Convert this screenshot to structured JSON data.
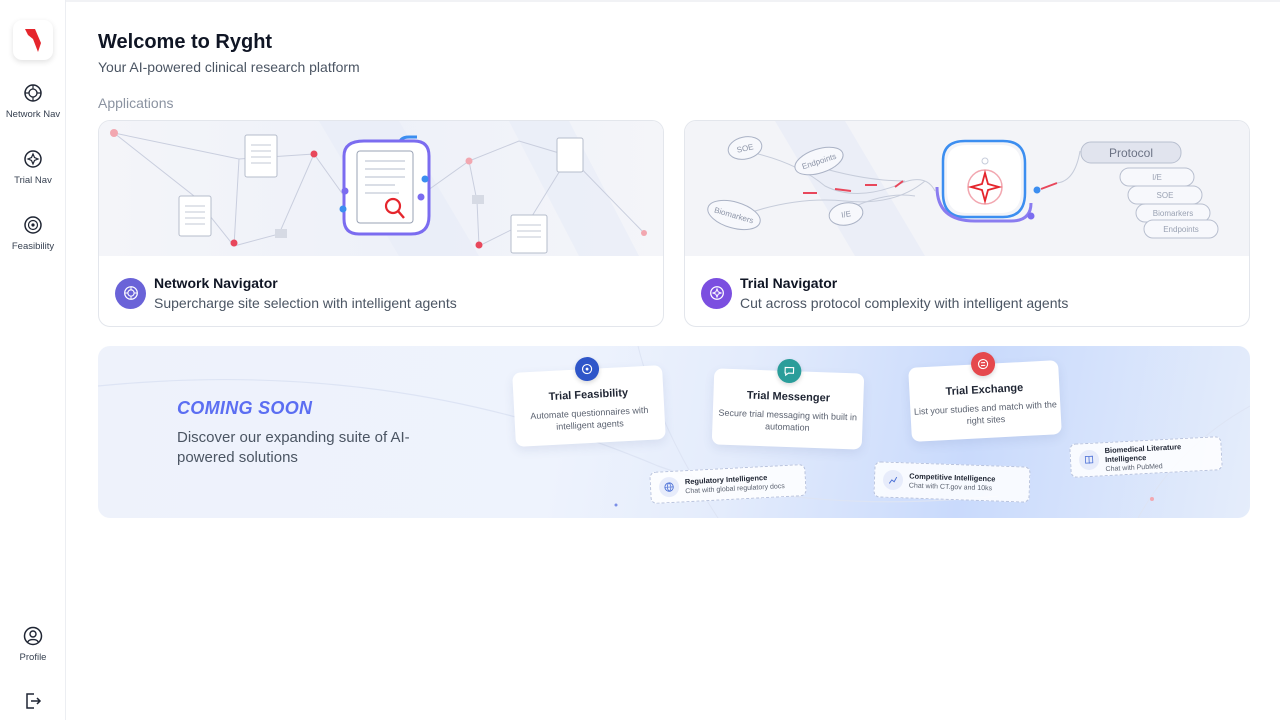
{
  "sidebar": {
    "items": [
      {
        "label": "Network Nav"
      },
      {
        "label": "Trial Nav"
      },
      {
        "label": "Feasibility"
      }
    ],
    "profile_label": "Profile"
  },
  "header": {
    "title": "Welcome to Ryght",
    "subtitle": "Your AI-powered clinical research platform"
  },
  "applications": {
    "section_label": "Applications",
    "cards": [
      {
        "name": "Network Navigator",
        "description": "Supercharge site selection with intelligent agents"
      },
      {
        "name": "Trial Navigator",
        "description": "Cut across protocol complexity with intelligent agents"
      }
    ],
    "trial_nav_illustration": {
      "bubbles": [
        "SOE",
        "Endpoints",
        "Biomarkers",
        "I/E"
      ],
      "protocol_label": "Protocol",
      "protocol_items": [
        "I/E",
        "SOE",
        "Biomarkers",
        "Endpoints"
      ]
    }
  },
  "coming_soon": {
    "heading": "COMING SOON",
    "description": "Discover our expanding suite of AI-powered solutions",
    "features": [
      {
        "name": "Trial Feasibility",
        "description": "Automate questionnaires with intelligent agents"
      },
      {
        "name": "Trial Messenger",
        "description": "Secure trial messaging with built in automation"
      },
      {
        "name": "Trial Exchange",
        "description": "List your studies and match with the right sites"
      }
    ],
    "mini_features": [
      {
        "name": "Regulatory Intelligence",
        "description": "Chat with global regulatory docs"
      },
      {
        "name": "Competitive Intelligence",
        "description": "Chat with CT.gov and 10ks"
      },
      {
        "name": "Biomedical Literature Intelligence",
        "description": "Chat with PubMed"
      }
    ]
  },
  "colors": {
    "brand_red": "#e5262d",
    "accent_purple": "#5b6ef2",
    "network_badge": "#6a63d8",
    "trial_badge": "#7b4fe0"
  }
}
